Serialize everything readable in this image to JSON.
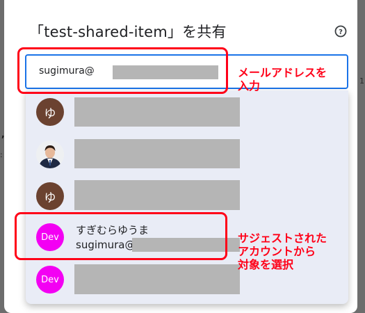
{
  "dialog": {
    "title": "「test-shared-item」を共有",
    "help_icon": "help-circle-icon"
  },
  "email_input": {
    "value": "sugimura@"
  },
  "suggestions": [
    {
      "avatar_type": "letter",
      "avatar_text": "ゆ",
      "avatar_color": "#6b4230"
    },
    {
      "avatar_type": "photo",
      "avatar_text": ""
    },
    {
      "avatar_type": "letter",
      "avatar_text": "ゆ",
      "avatar_color": "#6b4230"
    },
    {
      "avatar_type": "letter",
      "avatar_text": "Dev",
      "avatar_color": "#f300f3",
      "name": "すぎむらゆうま",
      "email": "sugimura@"
    },
    {
      "avatar_type": "letter",
      "avatar_text": "Dev",
      "avatar_color": "#f300f3"
    }
  ],
  "annotations": {
    "input_note": "メールアドレスを\n入力",
    "select_note": "サジェストされた\nアカウントから\n対象を選択",
    "highlight_color": "#ff0018"
  },
  "colors": {
    "focus_border": "#1a73e8",
    "dropdown_bg": "#e9ecf6",
    "redaction": "#b5b5b5"
  }
}
